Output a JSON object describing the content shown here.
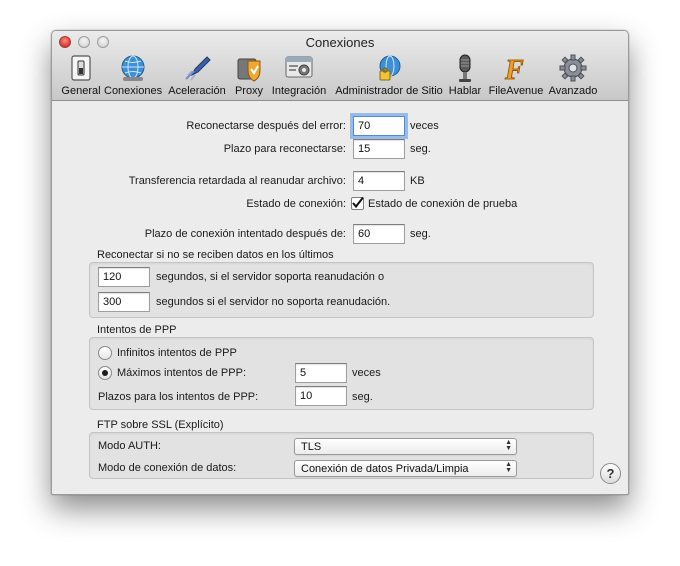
{
  "window": {
    "title": "Conexiones"
  },
  "toolbar": {
    "items": [
      {
        "label": "General",
        "icon": "switch-icon"
      },
      {
        "label": "Conexiones",
        "icon": "globe-icon"
      },
      {
        "label": "Aceleración",
        "icon": "rocket-icon"
      },
      {
        "label": "Proxy",
        "icon": "shield-icon"
      },
      {
        "label": "Integración",
        "icon": "window-gear-icon"
      },
      {
        "label": "Administrador de Sitio",
        "icon": "site-manager-icon"
      },
      {
        "label": "Hablar",
        "icon": "microphone-icon"
      },
      {
        "label": "FileAvenue",
        "icon": "fileavenue-icon"
      },
      {
        "label": "Avanzado",
        "icon": "gear-icon"
      }
    ]
  },
  "connection": {
    "reconnect_label": "Reconectarse después del error:",
    "reconnect_value": "70",
    "reconnect_unit": "veces",
    "delay_label": "Plazo para reconectarse:",
    "delay_value": "15",
    "delay_unit": "seg.",
    "transfer_label": "Transferencia retardada al reanudar archivo:",
    "transfer_value": "4",
    "transfer_unit": "KB",
    "status_label": "Estado de conexión:",
    "status_check_label": "Estado de conexión de prueba",
    "status_checked": true,
    "timeout_label": "Plazo de conexión intentado después de:",
    "timeout_value": "60",
    "timeout_unit": "seg."
  },
  "reconnect_section": {
    "title": "Reconectar si no se reciben datos en los últimos",
    "resume_value": "120",
    "resume_label": "segundos, si el servidor soporta reanudación o",
    "noresume_value": "300",
    "noresume_label": "segundos si el servidor no soporta reanudación."
  },
  "ppp_section": {
    "title": "Intentos de PPP",
    "infinite_label": "Infinitos intentos de PPP",
    "max_label": "Máximos intentos de PPP:",
    "max_value": "5",
    "max_unit": "veces",
    "selected": "max",
    "delay_label": "Plazos para los intentos de PPP:",
    "delay_value": "10",
    "delay_unit": "seg."
  },
  "ftp_section": {
    "title": "FTP sobre SSL (Explícito)",
    "auth_label": "Modo AUTH:",
    "auth_value": "TLS",
    "data_label": "Modo de conexión de datos:",
    "data_value": "Conexión de datos Privada/Limpia"
  },
  "help": {
    "label": "?"
  },
  "colors": {
    "focus": "#4a8ce0",
    "window_bg": "#ececec",
    "group_bg": "#e2e2e2"
  }
}
